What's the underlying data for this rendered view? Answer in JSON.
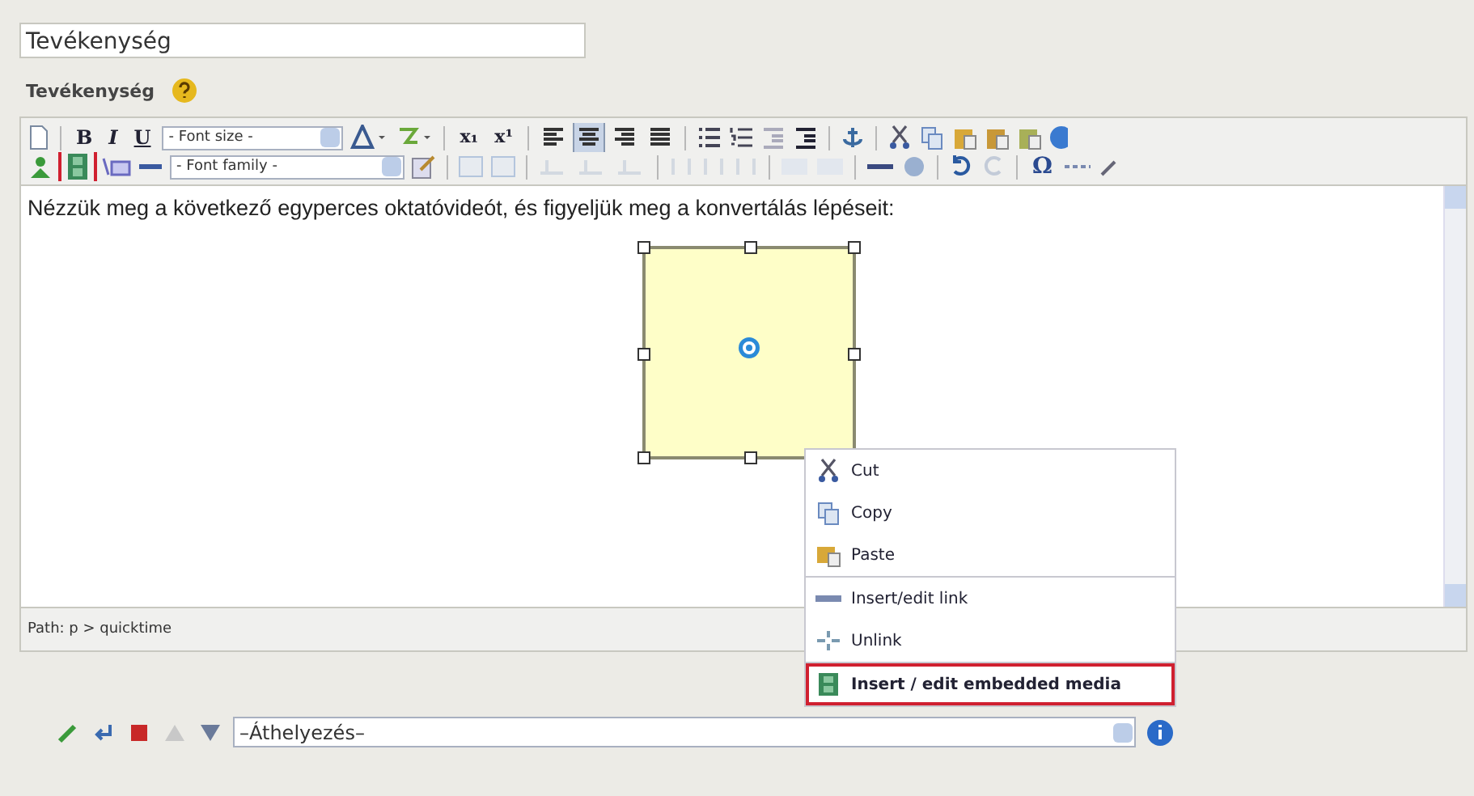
{
  "title_field": {
    "value": "Tevékenység"
  },
  "section_label": "Tevékenység",
  "toolbar": {
    "bold": "B",
    "italic": "I",
    "underline": "U",
    "font_size": "- Font size -",
    "subscript": "x₁",
    "superscript": "x¹",
    "font_family": "- Font family -",
    "special_char": "Ω",
    "media_highlighted": true,
    "align": [
      {
        "selected": false
      },
      {
        "selected": true
      },
      {
        "selected": false
      },
      {
        "selected": false
      }
    ]
  },
  "content": {
    "paragraph": "Nézzük meg a következő egyperces oktatóvideót, és figyeljük meg a konvertálás lépéseit:"
  },
  "path": "Path: p > quicktime",
  "context_menu": {
    "groups": [
      [
        {
          "label": "Cut",
          "highlighted": false
        },
        {
          "label": "Copy",
          "highlighted": false
        },
        {
          "label": "Paste",
          "highlighted": false
        }
      ],
      [
        {
          "label": "Insert/edit link",
          "highlighted": false
        },
        {
          "label": "Unlink",
          "highlighted": false
        }
      ],
      [
        {
          "label": "Insert / edit embedded media",
          "highlighted": true
        }
      ]
    ]
  },
  "move_select": {
    "value": "–Áthelyezés–"
  }
}
